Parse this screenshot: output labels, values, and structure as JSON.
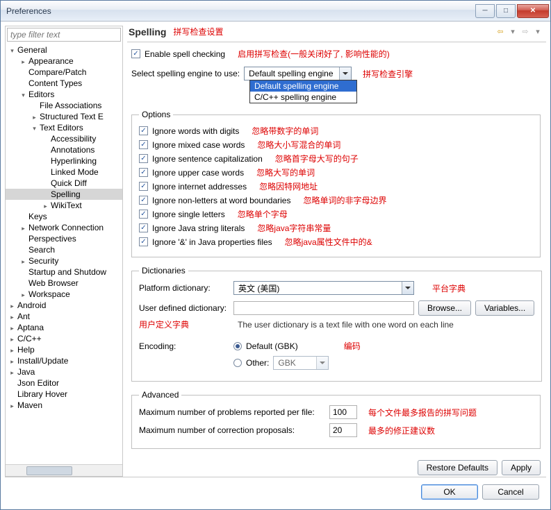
{
  "window": {
    "title": "Preferences"
  },
  "filter": {
    "placeholder": "type filter text"
  },
  "tree": [
    {
      "l": "General",
      "d": 0,
      "t": "-"
    },
    {
      "l": "Appearance",
      "d": 1,
      "t": "+"
    },
    {
      "l": "Compare/Patch",
      "d": 1,
      "t": ""
    },
    {
      "l": "Content Types",
      "d": 1,
      "t": ""
    },
    {
      "l": "Editors",
      "d": 1,
      "t": "-"
    },
    {
      "l": "File Associations",
      "d": 2,
      "t": ""
    },
    {
      "l": "Structured Text E",
      "d": 2,
      "t": "+"
    },
    {
      "l": "Text Editors",
      "d": 2,
      "t": "-"
    },
    {
      "l": "Accessibility",
      "d": 3,
      "t": ""
    },
    {
      "l": "Annotations",
      "d": 3,
      "t": ""
    },
    {
      "l": "Hyperlinking",
      "d": 3,
      "t": ""
    },
    {
      "l": "Linked Mode",
      "d": 3,
      "t": ""
    },
    {
      "l": "Quick Diff",
      "d": 3,
      "t": ""
    },
    {
      "l": "Spelling",
      "d": 3,
      "t": "",
      "sel": true
    },
    {
      "l": "WikiText",
      "d": 3,
      "t": "+"
    },
    {
      "l": "Keys",
      "d": 1,
      "t": ""
    },
    {
      "l": "Network Connection",
      "d": 1,
      "t": "+"
    },
    {
      "l": "Perspectives",
      "d": 1,
      "t": ""
    },
    {
      "l": "Search",
      "d": 1,
      "t": ""
    },
    {
      "l": "Security",
      "d": 1,
      "t": "+"
    },
    {
      "l": "Startup and Shutdow",
      "d": 1,
      "t": ""
    },
    {
      "l": "Web Browser",
      "d": 1,
      "t": ""
    },
    {
      "l": "Workspace",
      "d": 1,
      "t": "+"
    },
    {
      "l": "Android",
      "d": 0,
      "t": "+"
    },
    {
      "l": "Ant",
      "d": 0,
      "t": "+"
    },
    {
      "l": "Aptana",
      "d": 0,
      "t": "+"
    },
    {
      "l": "C/C++",
      "d": 0,
      "t": "+"
    },
    {
      "l": "Help",
      "d": 0,
      "t": "+"
    },
    {
      "l": "Install/Update",
      "d": 0,
      "t": "+"
    },
    {
      "l": "Java",
      "d": 0,
      "t": "+"
    },
    {
      "l": "Json Editor",
      "d": 0,
      "t": ""
    },
    {
      "l": "Library Hover",
      "d": 0,
      "t": ""
    },
    {
      "l": "Maven",
      "d": 0,
      "t": "+"
    }
  ],
  "header": {
    "title": "Spelling",
    "ann": "拼写检查设置"
  },
  "enable": {
    "label": "Enable spell checking",
    "ann": "启用拼写检查(一般关闭好了, 影响性能的)"
  },
  "engine": {
    "label": "Select spelling engine to use:",
    "value": "Default spelling engine",
    "options": [
      "Default spelling engine",
      "C/C++ spelling engine"
    ],
    "ann": "拼写检查引擎"
  },
  "options": {
    "legend": "Options",
    "items": [
      {
        "label": "Ignore words with digits",
        "ann": "忽略带数字的单词"
      },
      {
        "label": "Ignore mixed case words",
        "ann": "忽略大小写混合的单词"
      },
      {
        "label": "Ignore sentence capitalization",
        "ann": "忽略首字母大写的句子"
      },
      {
        "label": "Ignore upper case words",
        "ann": "忽略大写的单词"
      },
      {
        "label": "Ignore internet addresses",
        "ann": "忽略因特网地址"
      },
      {
        "label": "Ignore non-letters at word boundaries",
        "ann": "忽略单词的非字母边界"
      },
      {
        "label": "Ignore single letters",
        "ann": "忽略单个字母"
      },
      {
        "label": "Ignore Java string literals",
        "ann": "忽略java字符串常量"
      },
      {
        "label": "Ignore '&' in Java properties files",
        "ann": "忽略java属性文件中的&"
      }
    ]
  },
  "dict": {
    "legend": "Dictionaries",
    "platform_label": "Platform dictionary:",
    "platform_value": "英文 (美国)",
    "platform_ann": "平台字典",
    "user_label": "User defined dictionary:",
    "user_ann": "用户定义字典",
    "browse": "Browse...",
    "variables": "Variables...",
    "note": "The user dictionary is a text file with one word on each line",
    "enc_label": "Encoding:",
    "enc_default": "Default (GBK)",
    "enc_other": "Other:",
    "enc_other_value": "GBK",
    "enc_ann": "编码"
  },
  "adv": {
    "legend": "Advanced",
    "max_problems_label": "Maximum number of problems reported per file:",
    "max_problems_value": "100",
    "max_problems_ann": "每个文件最多报告的拼写问题",
    "max_proposals_label": "Maximum number of correction proposals:",
    "max_proposals_value": "20",
    "max_proposals_ann": "最多的修正建议数"
  },
  "footer": {
    "restore": "Restore Defaults",
    "apply": "Apply",
    "ok": "OK",
    "cancel": "Cancel"
  }
}
